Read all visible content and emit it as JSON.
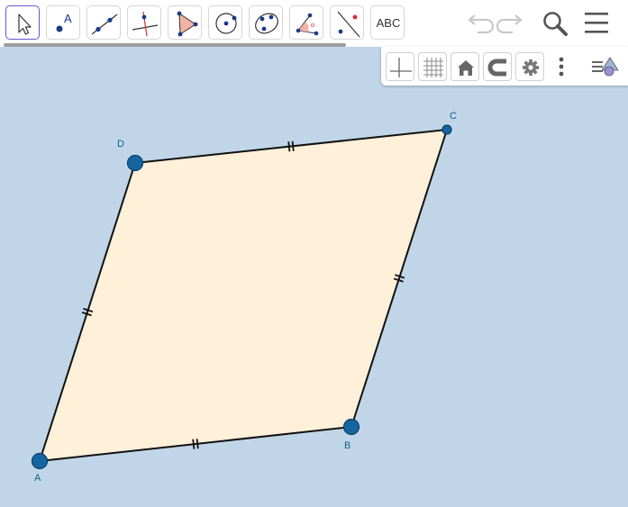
{
  "toolbar": {
    "tools": [
      {
        "name": "move-tool",
        "selected": true
      },
      {
        "name": "point-tool"
      },
      {
        "name": "line-tool"
      },
      {
        "name": "perpendicular-line-tool"
      },
      {
        "name": "polygon-tool"
      },
      {
        "name": "circle-tool"
      },
      {
        "name": "conic-tool"
      },
      {
        "name": "angle-tool"
      },
      {
        "name": "reflect-tool"
      },
      {
        "name": "text-tool",
        "label": "ABC"
      }
    ],
    "point_tool_label": "A",
    "actions": [
      "undo-icon",
      "redo-icon",
      "search-icon",
      "menu-icon"
    ]
  },
  "style_bar": {
    "buttons": [
      "axes-icon",
      "grid-icon",
      "home-icon",
      "magnet-icon",
      "gear-icon",
      "more-vertical-icon",
      "graphics-settings-icon"
    ]
  },
  "construction": {
    "fill_color": "#fef0d9",
    "edge_color": "#111111",
    "point_color": "#1565a0",
    "points": [
      {
        "label": "A"
      },
      {
        "label": "B"
      },
      {
        "label": "C"
      },
      {
        "label": "D"
      }
    ]
  },
  "colors": {
    "canvas_bg": "#c0d6e8",
    "accent": "#6557d2",
    "label_color": "#0e5f8c"
  }
}
